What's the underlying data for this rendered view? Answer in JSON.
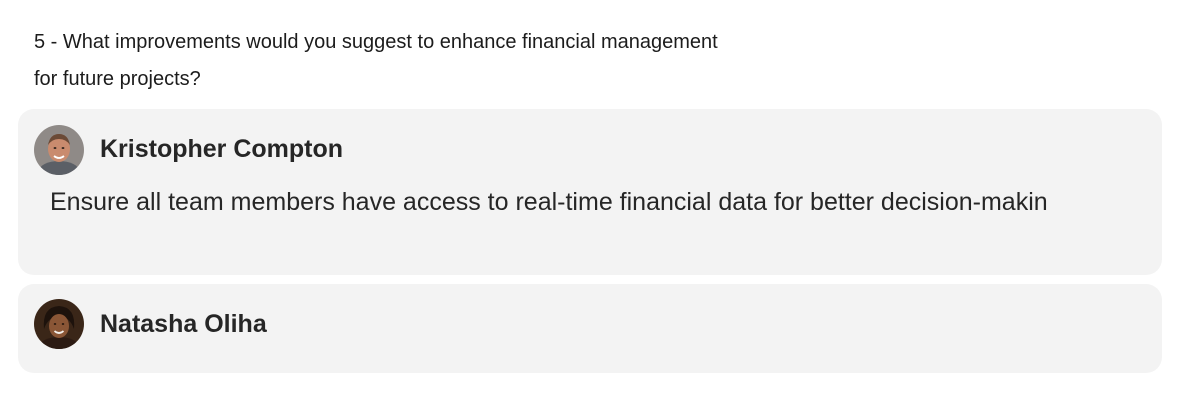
{
  "question": {
    "text": "5 - What improvements would you suggest to enhance financial management for future projects?"
  },
  "responses": [
    {
      "name": "Kristopher Compton",
      "answer": "Ensure all team members have access to real-time financial data for better decision-makin"
    },
    {
      "name": "Natasha Oliha",
      "answer": ""
    }
  ]
}
